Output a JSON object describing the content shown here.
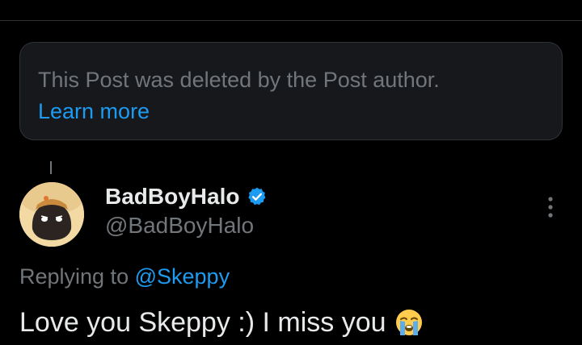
{
  "deleted_notice": {
    "text": "This Post was deleted by the Post author.",
    "learn_more": "Learn more"
  },
  "post": {
    "author_name": "BadBoyHalo",
    "author_handle": "@BadBoyHalo",
    "verified": true,
    "replying_label": "Replying to",
    "replying_to": "@Skeppy",
    "text": "Love you Skeppy :) I miss you",
    "emoji": "loudly-crying-face-icon"
  },
  "colors": {
    "background": "#000000",
    "accent": "#1d9bf0",
    "muted": "#71767b",
    "text": "#e7e9ea",
    "notice_bg": "#16181c",
    "border": "#2f3336"
  },
  "icons": {
    "verified": "verified-badge-icon",
    "more": "more-options-icon"
  }
}
